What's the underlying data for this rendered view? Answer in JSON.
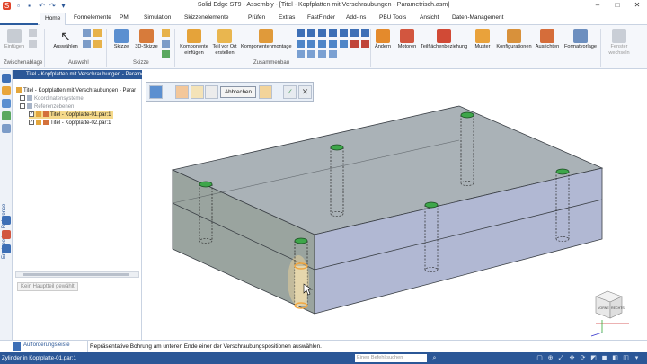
{
  "window": {
    "title": "Solid Edge ST9 - Assembly - [Titel - Kopfplatten mit Verschraubungen - Parametrisch.asm]",
    "minimize": "–",
    "maximize": "□",
    "close": "✕"
  },
  "tabs": [
    {
      "label": "Home"
    },
    {
      "label": "Formelemente"
    },
    {
      "label": "PMI"
    },
    {
      "label": "Simulation"
    },
    {
      "label": "Skizzenelemente"
    },
    {
      "label": "Prüfen"
    },
    {
      "label": "Extras"
    },
    {
      "label": "FastFinder"
    },
    {
      "label": "Add-Ins"
    },
    {
      "label": "PBU Tools"
    },
    {
      "label": "Ansicht"
    },
    {
      "label": "Daten-Management"
    }
  ],
  "ribbon": {
    "clipboard": {
      "einfuegen": "Einfügen",
      "group": "Zwischenablage"
    },
    "select": {
      "auswaehlen": "Auswählen",
      "group": "Auswahl"
    },
    "sketch": {
      "skizze": "Skizze",
      "skizze3d": "3D-Skizze",
      "group": "Skizze"
    },
    "assemble": {
      "komponente": "Komponente",
      "komponente2": "einfügen",
      "teilvorort": "Teil vor Ort",
      "teilvorort2": "erstellen",
      "montage": "Komponentenmontage",
      "group": "Zusammenbau"
    },
    "modify": {
      "aendern": "Ändern",
      "motoren": "Motoren",
      "teilflaechen": "Teilflächenbeziehung",
      "muster": "Muster",
      "konfig": "Konfigurationen",
      "ausrichten": "Ausrichten",
      "formatvorlage": "Formatvorlage",
      "fenster": "Fenster",
      "fenster2": "wechseln"
    }
  },
  "pathfinder": {
    "header": "Titel - Kopfplatten mit Verschraubungen - Parametrisch.asm",
    "root": "Titel - Kopfplatten mit Verschraubungen - Parar",
    "koordinatensysteme": "Koordinatensysteme",
    "referenzebenen": "Referenzebenen",
    "part1": "Titel - Kopfplatte-01.par:1",
    "part2": "Titel - Kopfplatte-02.par:1",
    "kein_hauptteil": "Kein Hauptteil gewählt"
  },
  "left_strip": {
    "engineering_reference": "Engineering Reference"
  },
  "command_bar": {
    "abbrechen": "Abbrechen"
  },
  "viewcube": {
    "face1": "VORNE",
    "face2": "RECHTS"
  },
  "prompt": {
    "label": "Aufforderungsleiste",
    "text": "Repräsentative Bohrung am unteren Ende einer der Verschraubungspositionen auswählen."
  },
  "status": {
    "text": "Zylinder in Kopfplatte-01.par:1",
    "find_placeholder": "Einen Befehl suchen"
  },
  "colors": {
    "accent": "#2b5797",
    "selection": "#f5d98a",
    "plate_top": "#aab2b7",
    "plate_front": "#9aa49f",
    "plate_side": "#b1b8d3",
    "hole_green": "#3ea64a",
    "highlight": "#f0a640"
  }
}
